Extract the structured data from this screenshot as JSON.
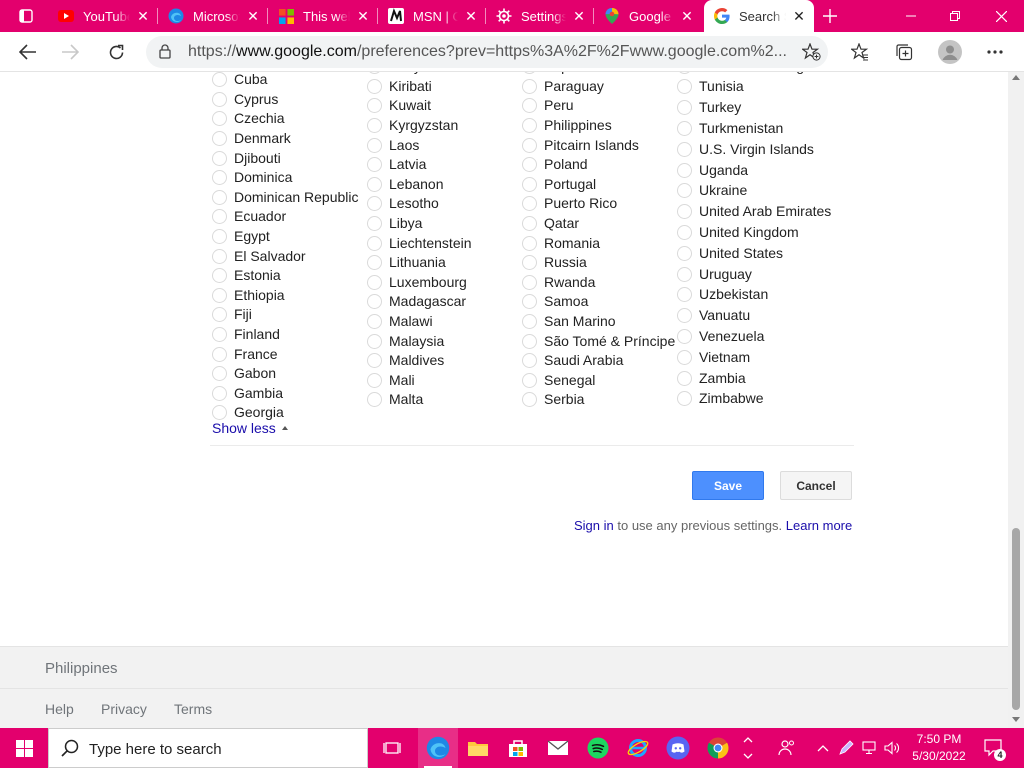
{
  "browser": {
    "tabs": [
      {
        "title": "YouTube",
        "icon": "youtube-icon"
      },
      {
        "title": "Microsoft",
        "icon": "edge-icon"
      },
      {
        "title": "This website",
        "icon": "microsoft-logo-icon"
      },
      {
        "title": "MSN | Outlook",
        "icon": "msn-icon"
      },
      {
        "title": "Settings",
        "icon": "gear-icon"
      },
      {
        "title": "Google Maps",
        "icon": "maps-pin-icon"
      },
      {
        "title": "Search Settings",
        "icon": "google-icon",
        "active": true
      }
    ],
    "url_scheme": "https://",
    "url_host": "www.google.com",
    "url_rest": "/preferences?prev=https%3A%2F%2Fwww.google.com%2..."
  },
  "regions": {
    "col1": [
      "Cuba",
      "Cyprus",
      "Czechia",
      "Denmark",
      "Djibouti",
      "Dominica",
      "Dominican Republic",
      "Ecuador",
      "Egypt",
      "El Salvador",
      "Estonia",
      "Ethiopia",
      "Fiji",
      "Finland",
      "France",
      "Gabon",
      "Gambia",
      "Georgia"
    ],
    "col2": [
      "Kenya",
      "Kiribati",
      "Kuwait",
      "Kyrgyzstan",
      "Laos",
      "Latvia",
      "Lebanon",
      "Lesotho",
      "Libya",
      "Liechtenstein",
      "Lithuania",
      "Luxembourg",
      "Madagascar",
      "Malawi",
      "Malaysia",
      "Maldives",
      "Mali",
      "Malta"
    ],
    "col3": [
      "Papua New Guinea",
      "Paraguay",
      "Peru",
      "Philippines",
      "Pitcairn Islands",
      "Poland",
      "Portugal",
      "Puerto Rico",
      "Qatar",
      "Romania",
      "Russia",
      "Rwanda",
      "Samoa",
      "San Marino",
      "São Tomé & Príncipe",
      "Saudi Arabia",
      "Senegal",
      "Serbia"
    ],
    "col4": [
      "Trinidad & Tobago",
      "Tunisia",
      "Turkey",
      "Turkmenistan",
      "U.S. Virgin Islands",
      "Uganda",
      "Ukraine",
      "United Arab Emirates",
      "United Kingdom",
      "United States",
      "Uruguay",
      "Uzbekistan",
      "Vanuatu",
      "Venezuela",
      "Vietnam",
      "Zambia",
      "Zimbabwe"
    ]
  },
  "page": {
    "show_less": "Show less",
    "save": "Save",
    "cancel": "Cancel",
    "sign_in": "Sign in",
    "sign_in_rest": "to use any previous settings.",
    "learn_more": "Learn more"
  },
  "footer": {
    "location": "Philippines",
    "links": [
      "Help",
      "Privacy",
      "Terms"
    ]
  },
  "taskbar": {
    "search_placeholder": "Type here to search",
    "time": "7:50 PM",
    "date": "5/30/2022",
    "notifications": "4"
  },
  "colors": {
    "accent": "#e3006d",
    "link": "#1a0dab",
    "save_button": "#4d90fe"
  }
}
